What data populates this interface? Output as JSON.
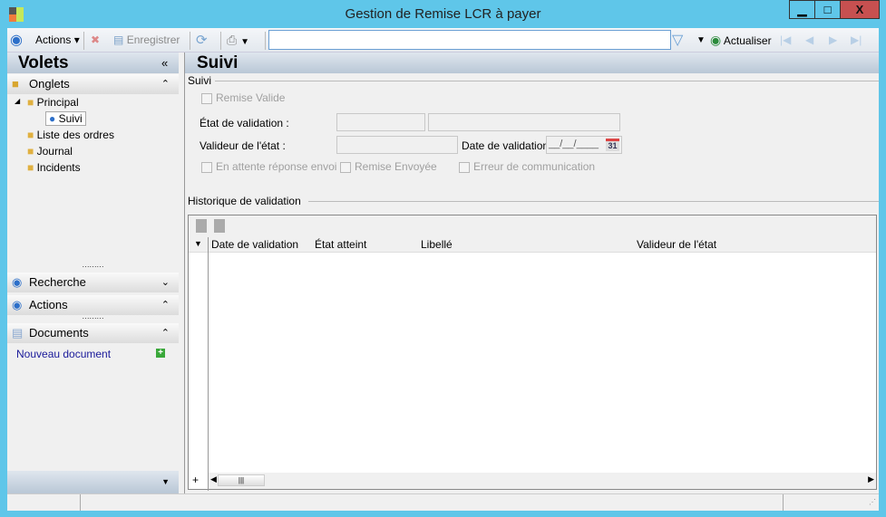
{
  "window": {
    "title": "Gestion de Remise LCR à payer",
    "minimize": "▁",
    "maximize": "□",
    "close": "X"
  },
  "toolbar": {
    "actions": "Actions",
    "save": "Enregistrer",
    "refresh": "Actualiser",
    "search_value": ""
  },
  "left": {
    "title": "Volets",
    "collapse": "«",
    "onglets": {
      "label": "Onglets",
      "tree": [
        {
          "label": "Principal"
        },
        {
          "label": "Suivi"
        },
        {
          "label": "Liste des ordres"
        },
        {
          "label": "Journal"
        },
        {
          "label": "Incidents"
        }
      ]
    },
    "recherche": "Recherche",
    "actions": "Actions",
    "documents": "Documents",
    "new_document": "Nouveau document"
  },
  "main": {
    "title": "Suivi",
    "group": "Suivi",
    "remise_valide": "Remise Valide",
    "etat_label": "État de validation :",
    "valideur_label": "Valideur de l'état :",
    "date_label": "Date de validation :",
    "date_value": "__/__/____",
    "calendar_day": "31",
    "cb_attente": "En attente réponse envoi",
    "cb_envoyee": "Remise Envoyée",
    "cb_erreur": "Erreur de communication",
    "history": "Historique de validation",
    "columns": [
      "Date de validation",
      "État atteint",
      "Libellé",
      "Valideur de l'état"
    ],
    "add": "+"
  }
}
